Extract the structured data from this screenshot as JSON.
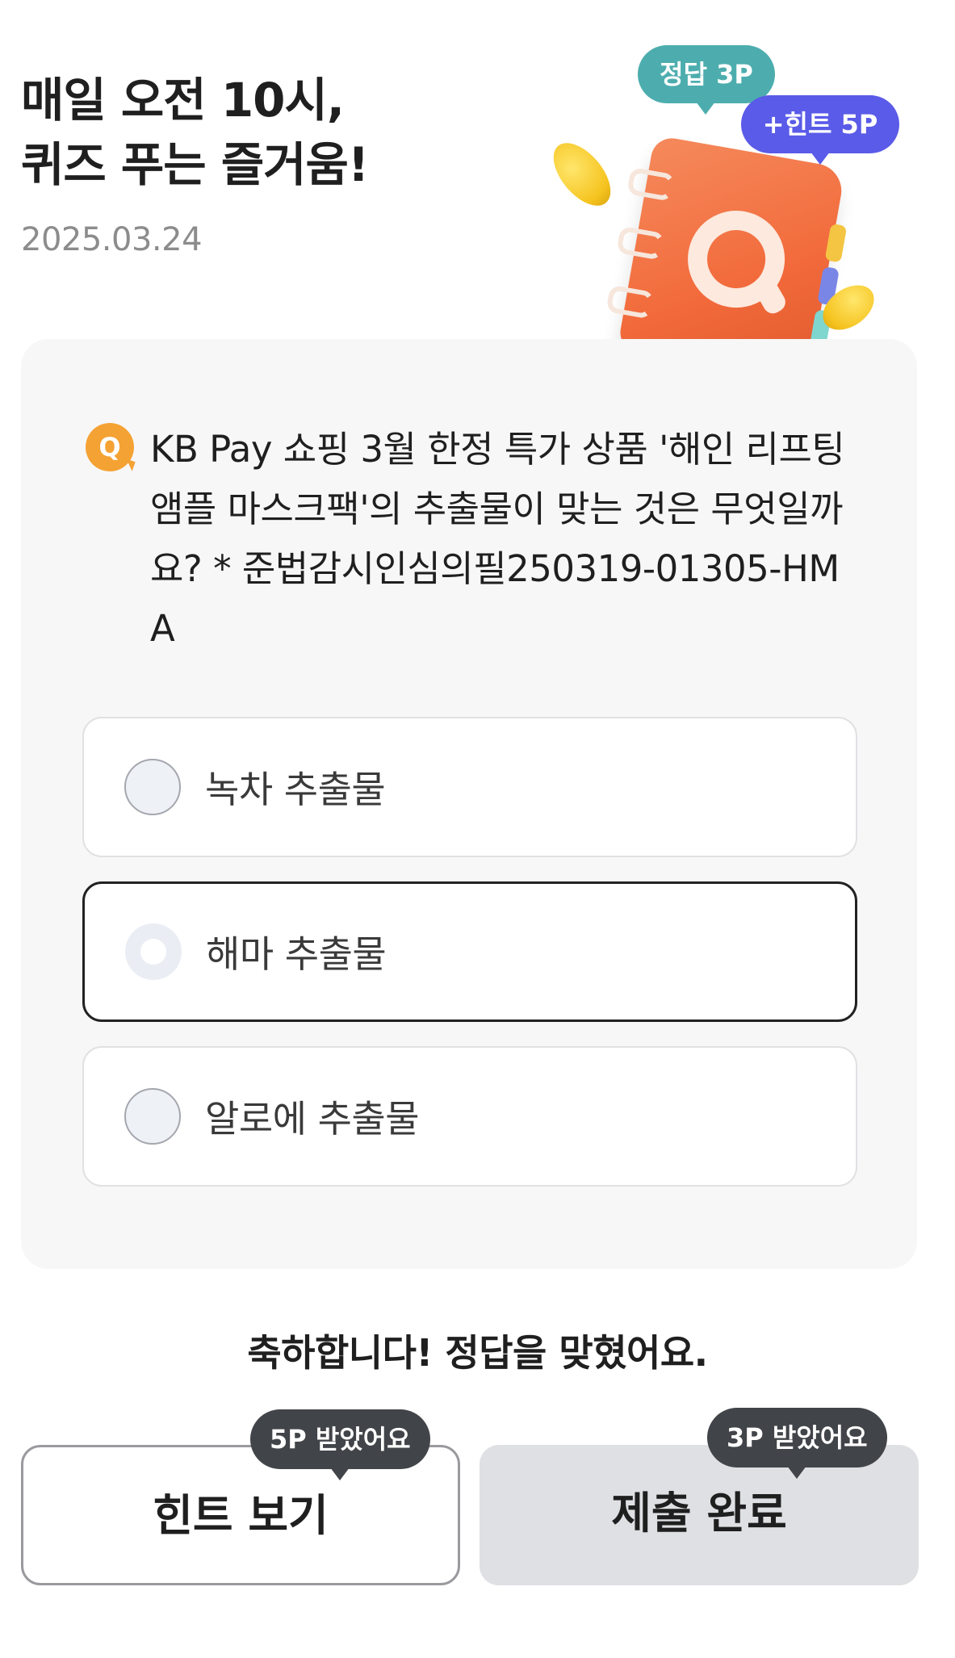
{
  "header": {
    "title_line1": "매일 오전 10시,",
    "title_line2": "퀴즈 푸는 즐거움!",
    "date": "2025.03.24"
  },
  "illustration": {
    "answer_badge": "정답 3P",
    "hint_badge": "+힌트 5P",
    "icon": "q-notebook-icon",
    "colors": {
      "answer_badge": "#4dadae",
      "hint_badge": "#5a5be8",
      "notebook": "#f26a3b"
    }
  },
  "quiz": {
    "q_icon_label": "Q",
    "question": "KB Pay 쇼핑 3월 한정 특가 상품 '해인 리프팅 앰플 마스크팩'의 추출물이 맞는 것은 무엇일까요? * 준법감시인심의필250319-01305-HMA",
    "options": [
      {
        "label": "녹차 추출물",
        "selected": false
      },
      {
        "label": "해마 추출물",
        "selected": true
      },
      {
        "label": "알로에 추출물",
        "selected": false
      }
    ]
  },
  "result": {
    "message": "축하합니다! 정답을 맞혔어요."
  },
  "buttons": {
    "hint": {
      "label": "힌트 보기",
      "tooltip": "5P 받았어요"
    },
    "submit": {
      "label": "제출 완료",
      "tooltip": "3P 받았어요"
    }
  },
  "colors": {
    "accent_q": "#f5a234",
    "card_bg": "#f7f7f8",
    "tooltip_bg": "#414448",
    "submit_bg": "#dfe0e3"
  }
}
